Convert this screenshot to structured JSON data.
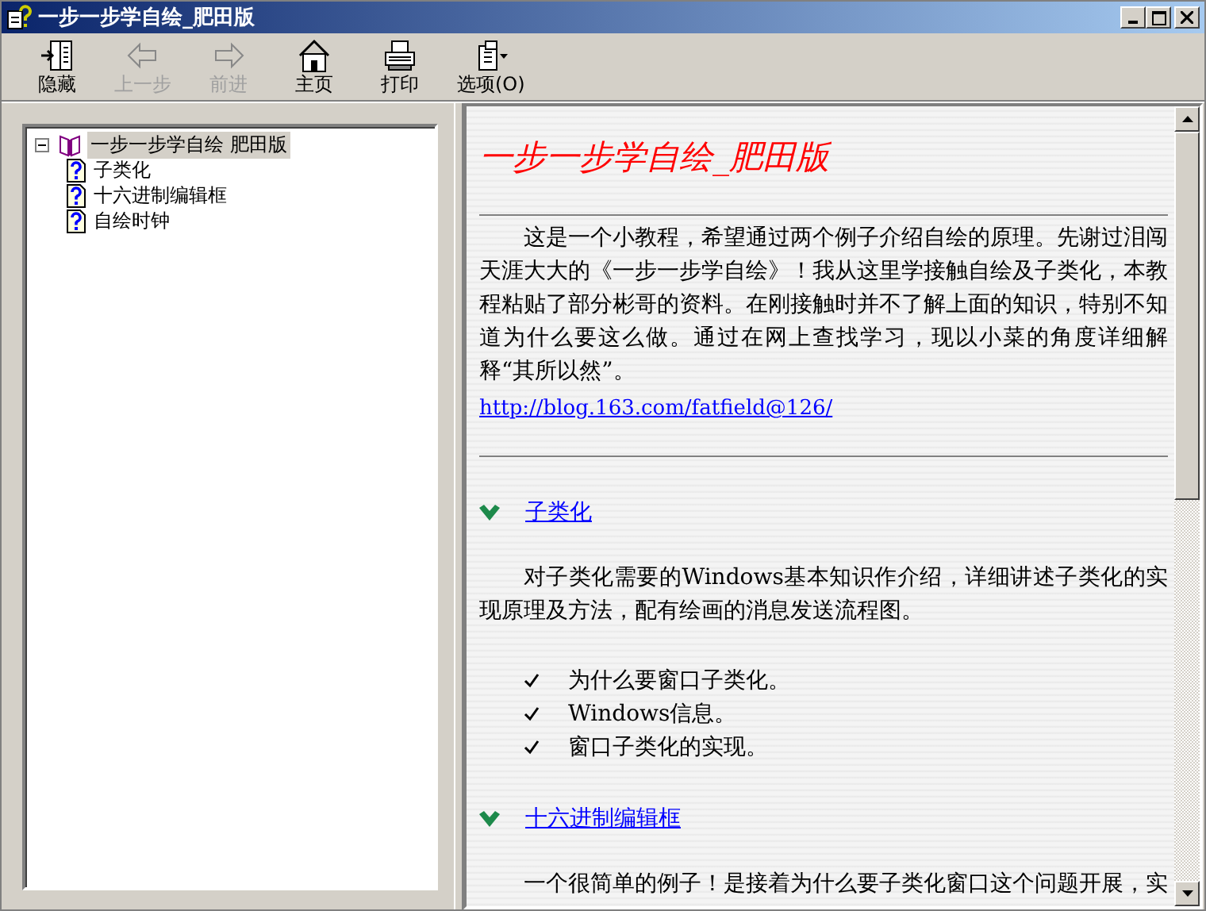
{
  "window": {
    "title": "一步一步学自绘_肥田版"
  },
  "toolbar": [
    {
      "kind": "hide",
      "label": "隐藏",
      "disabled": false
    },
    {
      "kind": "back",
      "label": "上一步",
      "disabled": true
    },
    {
      "kind": "forward",
      "label": "前进",
      "disabled": true
    },
    {
      "kind": "home",
      "label": "主页",
      "disabled": false
    },
    {
      "kind": "print",
      "label": "打印",
      "disabled": false
    },
    {
      "kind": "options",
      "label": "选项(O)",
      "disabled": false
    }
  ],
  "tree": [
    {
      "label": "一步一步学自绘 肥田版",
      "kind": "book",
      "expanded": true,
      "selected": true,
      "children": [
        {
          "label": "子类化",
          "kind": "page",
          "selected": false
        },
        {
          "label": "十六进制编辑框",
          "kind": "page",
          "selected": false
        },
        {
          "label": "自绘时钟",
          "kind": "page",
          "selected": false
        }
      ]
    }
  ],
  "content": {
    "title": "一步一步学自绘_肥田版",
    "intro": "这是一个小教程，希望通过两个例子介绍自绘的原理。先谢过泪闯天涯大大的《一步一步学自绘》！我从这里学接触自绘及子类化，本教程粘贴了部分彬哥的资料。在刚接触时并不了解上面的知识，特别不知道为什么要这么做。通过在网上查找学习，现以小菜的角度详细解释“其所以然”。",
    "link": "http://blog.163.com/fatfield@126/",
    "sections": [
      {
        "heading": "子类化",
        "body": "对子类化需要的Windows基本知识作介绍，详细讲述子类化的实现原理及方法，配有绘画的消息发送流程图。",
        "bullets": [
          "为什么要窗口子类化。",
          "Windows信息。",
          "窗口子类化的实现。"
        ]
      },
      {
        "heading": "十六进制编辑框",
        "body": "一个很简单的例子！是接着为什么要子类化窗口这个问题开展，实"
      }
    ]
  }
}
